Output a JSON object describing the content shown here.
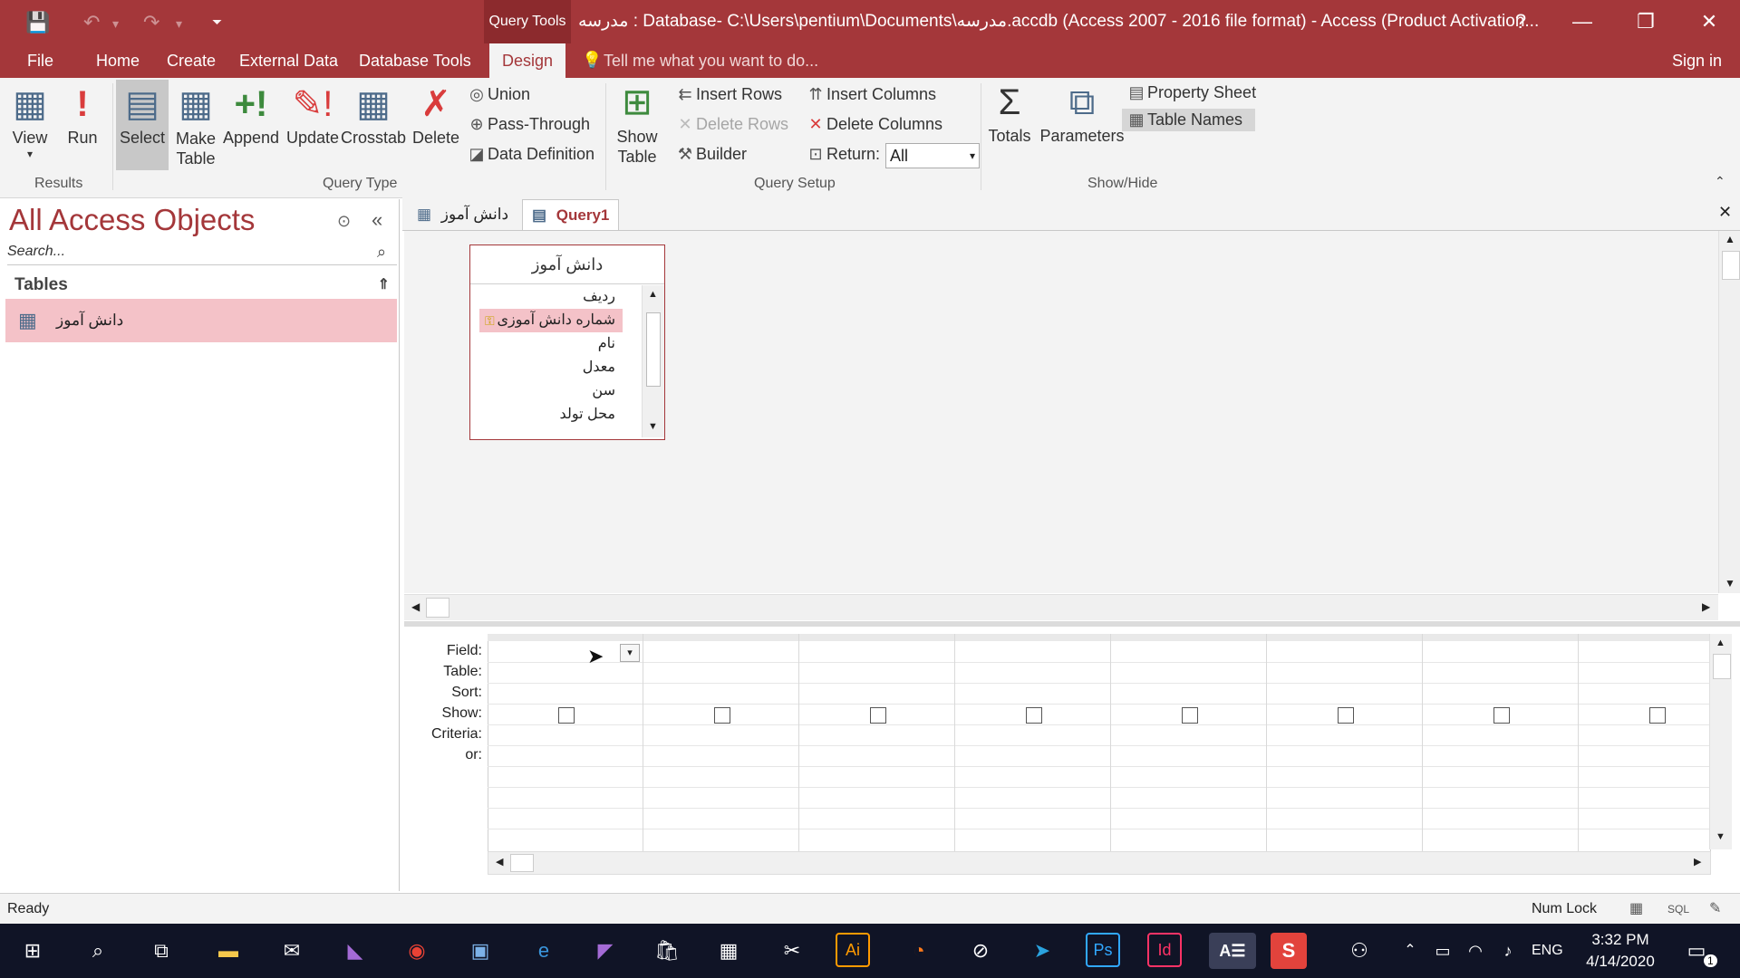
{
  "titlebar": {
    "context_tab": "Query Tools",
    "window_title": "مدرسه : Database- C:\\Users\\pentium\\Documents\\مدرسه.accdb (Access 2007 - 2016 file format) - Access (Product Activation...",
    "help": "?",
    "minimize": "—",
    "restore": "❐",
    "close": "✕"
  },
  "menu": {
    "file": "File",
    "home": "Home",
    "create": "Create",
    "external": "External Data",
    "dbtools": "Database Tools",
    "design": "Design",
    "tellme": "Tell me what you want to do...",
    "signin": "Sign in"
  },
  "ribbon": {
    "results": {
      "label": "Results",
      "view": "View",
      "run": "Run"
    },
    "query_type": {
      "label": "Query Type",
      "select": "Select",
      "make_table_1": "Make",
      "make_table_2": "Table",
      "append": "Append",
      "update": "Update",
      "crosstab": "Crosstab",
      "delete": "Delete",
      "union": "Union",
      "pass_through": "Pass-Through",
      "data_definition": "Data Definition"
    },
    "query_setup": {
      "label": "Query Setup",
      "show_table_1": "Show",
      "show_table_2": "Table",
      "insert_rows": "Insert Rows",
      "delete_rows": "Delete Rows",
      "builder": "Builder",
      "insert_columns": "Insert Columns",
      "delete_columns": "Delete Columns",
      "return_label": "Return:",
      "return_value": "All"
    },
    "show_hide": {
      "label": "Show/Hide",
      "totals": "Totals",
      "parameters": "Parameters",
      "property_sheet": "Property Sheet",
      "table_names": "Table Names"
    }
  },
  "nav": {
    "title": "All Access Objects",
    "search_placeholder": "Search...",
    "section": "Tables",
    "item": "دانش آموز"
  },
  "doctabs": [
    {
      "label": "دانش آموز"
    },
    {
      "label": "Query1"
    }
  ],
  "table_box": {
    "title": "دانش آموز",
    "fields": [
      "ردیف",
      "شماره دانش آموزی",
      "نام",
      "معدل",
      "سن",
      "محل تولد"
    ]
  },
  "grid": {
    "row_labels": [
      "Field:",
      "Table:",
      "Sort:",
      "Show:",
      "Criteria:",
      "or:"
    ],
    "columns": 8
  },
  "status": {
    "left": "Ready",
    "numlock": "Num Lock",
    "sql": "SQL"
  },
  "taskbar": {
    "lang": "ENG",
    "time": "3:32 PM",
    "date": "4/14/2020",
    "notif_count": "1"
  }
}
